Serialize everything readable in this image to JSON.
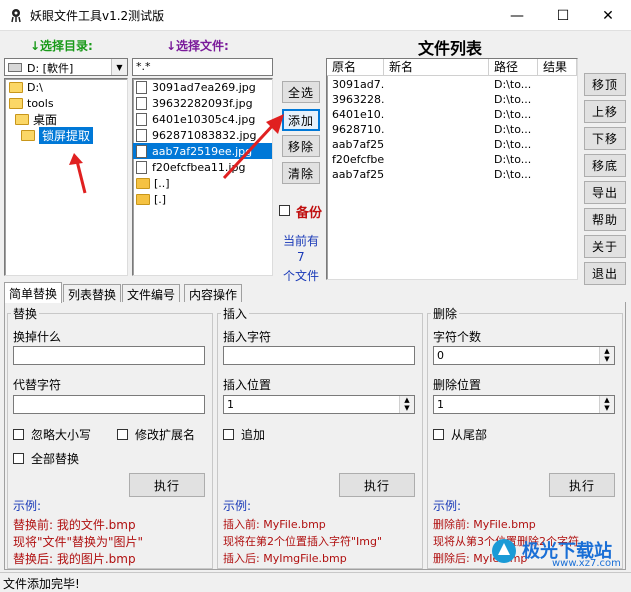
{
  "window": {
    "title": "妖眼文件工具v1.2测试版",
    "minimize": "—",
    "maximize": "☐",
    "close": "✕"
  },
  "labels": {
    "select_dir": "↓选择目录:",
    "select_file": "↓选择文件:",
    "file_list": "文件列表"
  },
  "drive_combo": {
    "value": "D: [軟件]"
  },
  "tree": [
    "D:\\",
    "tools",
    "桌面",
    "锁屏提取"
  ],
  "filter": {
    "value": "*.*"
  },
  "files": [
    "3091ad7ea269.jpg",
    "39632282093f.jpg",
    "6401e10305c4.jpg",
    "962871083832.jpg",
    "aab7af2519ee.jpg",
    "f20efcfbea11.jpg",
    "[..]",
    "[.]"
  ],
  "mid_buttons": {
    "select_all": "全选",
    "add": "添加",
    "remove": "移除",
    "clear": "清除"
  },
  "backup": {
    "label": "备份"
  },
  "count": {
    "line1": "当前有",
    "line2": "7",
    "line3": "个文件"
  },
  "table": {
    "headers": [
      "原名",
      "新名",
      "路径",
      "结果"
    ],
    "rows": [
      {
        "orig": "3091ad7...",
        "path": "D:\\to..."
      },
      {
        "orig": "3963228...",
        "path": "D:\\to..."
      },
      {
        "orig": "6401e10...",
        "path": "D:\\to..."
      },
      {
        "orig": "9628710...",
        "path": "D:\\to..."
      },
      {
        "orig": "aab7af25...",
        "path": "D:\\to..."
      },
      {
        "orig": "f20efcfbe...",
        "path": "D:\\to..."
      },
      {
        "orig": "aab7af25...",
        "path": "D:\\to..."
      }
    ]
  },
  "right_buttons": {
    "top": "移顶",
    "up": "上移",
    "down": "下移",
    "bottom": "移底",
    "export": "导出",
    "help": "帮助",
    "about": "关于",
    "exit": "退出"
  },
  "tabs": [
    "简单替换",
    "列表替换",
    "文件编号",
    "内容操作"
  ],
  "replace": {
    "group": "替换",
    "find_label": "换掉什么",
    "replace_label": "代替字符",
    "ignore_case": "忽略大小写",
    "change_ext": "修改扩展名",
    "replace_all": "全部替换",
    "run": "执行",
    "example_title": "示例:",
    "ex1": "替换前: 我的文件.bmp",
    "ex2": "现将\"文件\"替换为\"图片\"",
    "ex3": "替换后: 我的图片.bmp"
  },
  "insert": {
    "group": "插入",
    "char_label": "插入字符",
    "pos_label": "插入位置",
    "pos_value": "1",
    "append": "追加",
    "run": "执行",
    "example_title": "示例:",
    "ex1": "插入前: MyFile.bmp",
    "ex2": "现将在第2个位置插入字符\"Img\"",
    "ex3": "插入后: MyImgFile.bmp"
  },
  "delete": {
    "group": "删除",
    "count_label": "字符个数",
    "count_value": "0",
    "pos_label": "删除位置",
    "pos_value": "1",
    "from_end": "从尾部",
    "run": "执行",
    "example_title": "示例:",
    "ex1": "删除前: MyFile.bmp",
    "ex2": "现将从第3个位置删除2个字符",
    "ex3": "删除后: MyIe.bmp"
  },
  "status": {
    "text": "文件添加完毕!"
  },
  "watermark": {
    "text": "极光下载站",
    "url": "www.xz7.com"
  },
  "colors": {
    "accent": "#0078d7",
    "arrow": "#e02020",
    "green": "#1a9a1a",
    "purple": "#7a1a9a",
    "blue": "#1a3ab8",
    "red": "#b01010"
  }
}
